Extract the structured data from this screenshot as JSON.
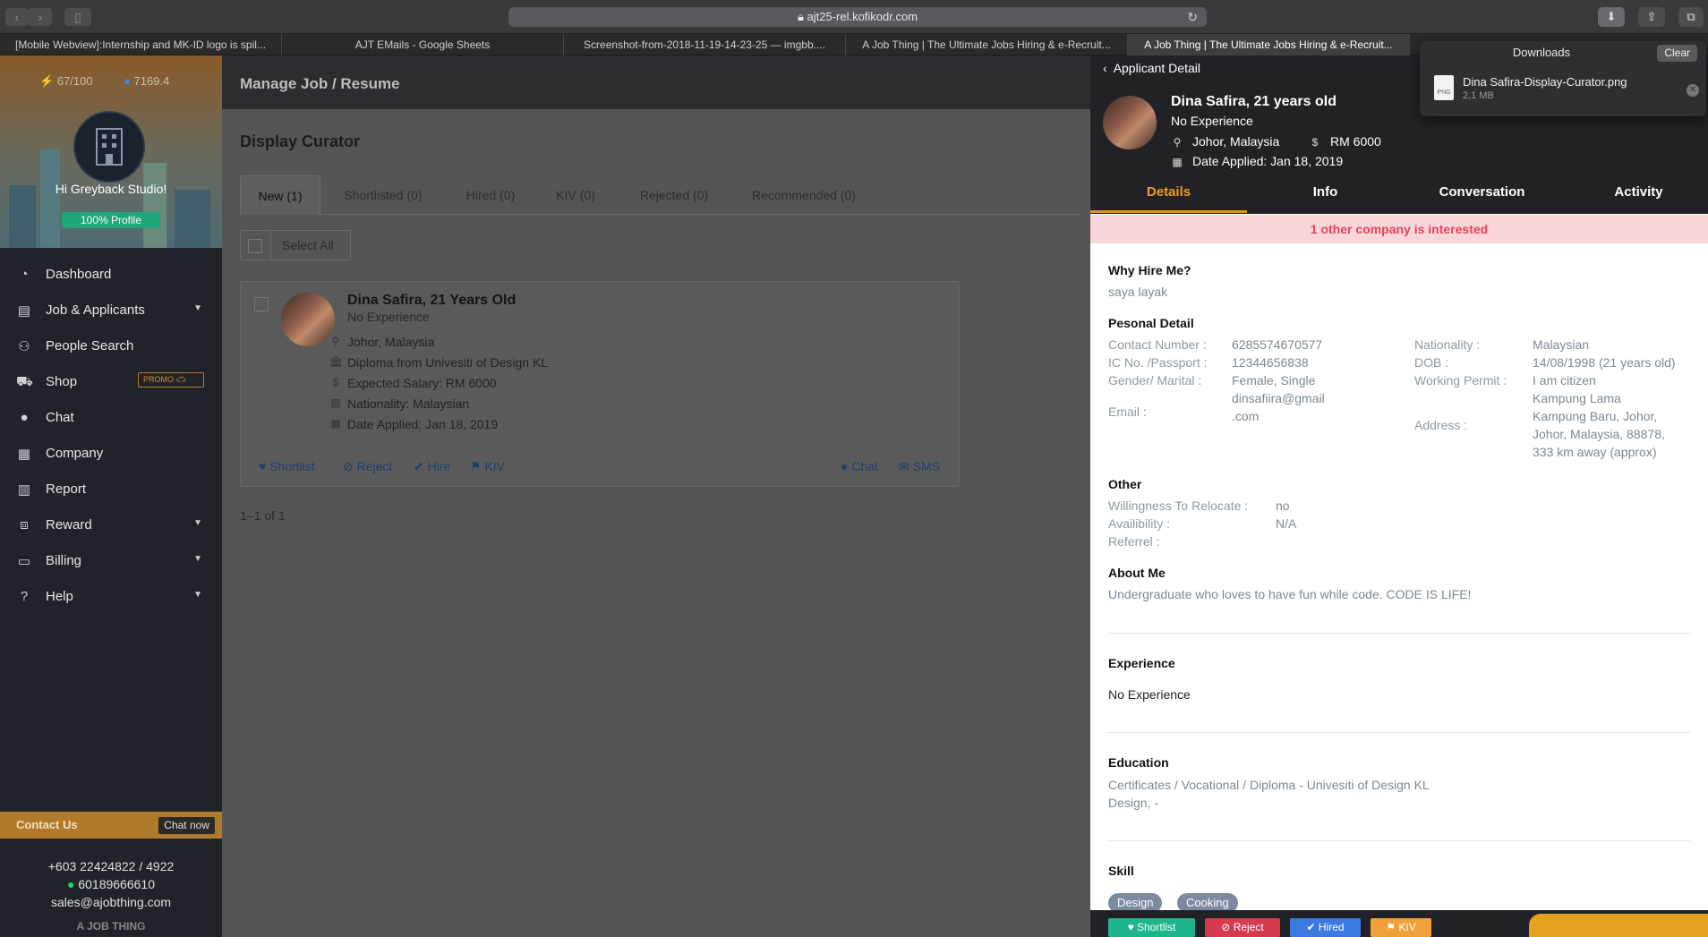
{
  "browser": {
    "url": "ajt25-rel.kofikodr.com",
    "tabs": [
      "[Mobile Webview]:Internship and MK-ID logo is spil...",
      "AJT EMails - Google Sheets",
      "Screenshot-from-2018-11-19-14-23-25 — imgbb....",
      "A Job Thing | The Ultimate Jobs Hiring & e-Recruit...",
      "A Job Thing | The Ultimate Jobs Hiring & e-Recruit..."
    ]
  },
  "downloads": {
    "title": "Downloads",
    "clear_label": "Clear",
    "file_type": "PNG",
    "file_name": "Dina Safira-Display-Curator.png",
    "file_size": "2,1 MB"
  },
  "sidebar": {
    "energy": "67/100",
    "credits": "7169.4",
    "greeting": "Hi Greyback Studio!",
    "profile_badge": "100% Profile",
    "promo_badge": "PROMO",
    "items": [
      {
        "label": "Dashboard",
        "icon": "dashboard-icon",
        "glyph": "◔"
      },
      {
        "label": "Job & Applicants",
        "icon": "document-icon",
        "glyph": "▤",
        "caret": true
      },
      {
        "label": "People Search",
        "icon": "people-icon",
        "glyph": "⚇"
      },
      {
        "label": "Shop",
        "icon": "cart-icon",
        "glyph": "⛟"
      },
      {
        "label": "Chat",
        "icon": "chat-icon",
        "glyph": "●"
      },
      {
        "label": "Company",
        "icon": "building-icon",
        "glyph": "▦"
      },
      {
        "label": "Report",
        "icon": "bar-chart-icon",
        "glyph": "▥"
      },
      {
        "label": "Reward",
        "icon": "gift-icon",
        "glyph": "⧈",
        "caret": true
      },
      {
        "label": "Billing",
        "icon": "credit-card-icon",
        "glyph": "▭",
        "caret": true
      },
      {
        "label": "Help",
        "icon": "question-icon",
        "glyph": "?",
        "caret": true
      }
    ],
    "contact_title": "Contact Us",
    "chat_now": "Chat now",
    "phone": "+603 22424822 / 4922",
    "whatsapp": "60189666610",
    "email": "sales@ajobthing.com",
    "logo_text": "A JOB THING"
  },
  "main": {
    "header": "Manage Job / Resume",
    "job_title": "Display Curator",
    "tabs": [
      "New (1)",
      "Shortlisted (0)",
      "Hired (0)",
      "KIV (0)",
      "Rejected (0)",
      "Recommended (0)"
    ],
    "select_all": "Select All",
    "card": {
      "name": "Dina Safira, 21 Years Old",
      "experience": "No Experience",
      "location": "Johor, Malaysia",
      "education": "Diploma from Univesiti of Design KL",
      "salary": "Expected Salary: RM 6000",
      "nationality": "Nationality: Malaysian",
      "date_applied": "Date Applied: Jan 18, 2019",
      "actions": [
        "Shortlist",
        "Reject",
        "Hire",
        "KIV"
      ],
      "chat": "Chat",
      "sms": "SMS"
    },
    "pager": "1–1 of 1"
  },
  "panel": {
    "back_label": "Applicant Detail",
    "name": "Dina Safira, 21 years old",
    "experience": "No Experience",
    "location": "Johor, Malaysia",
    "salary": "RM 6000",
    "date_applied": "Date Applied: Jan 18, 2019",
    "tabs": [
      "Details",
      "Info",
      "Conversation",
      "Activity"
    ],
    "interest_banner": "1 other company is interested",
    "why_hire_title": "Why Hire Me?",
    "why_hire": "saya layak",
    "personal_title": "Pesonal Detail",
    "contact_label": "Contact Number :",
    "contact": "6285574670577",
    "ic_label": "IC No. /Passport :",
    "ic": "12344656838",
    "gender_label": "Gender/ Marital :",
    "gender": "Female, Single",
    "email_label": "Email :",
    "email_line1": "dinsafiira@gmail",
    "email_line2": ".com",
    "nationality_label": "Nationality :",
    "nationality": "Malaysian",
    "dob_label": "DOB :",
    "dob": "14/08/1998 (21 years old)",
    "permit_label": "Working Permit :",
    "permit": "I am citizen",
    "address_label": "Address :",
    "address_lines": [
      "Kampung Lama",
      "Kampung Baru, Johor,",
      "Johor, Malaysia, 88878,",
      "333 km away (approx)"
    ],
    "other_title": "Other",
    "relocate_label": "Willingness To Relocate :",
    "relocate": "no",
    "avail_label": "Availibility :",
    "avail": "N/A",
    "referrel_label": "Referrel :",
    "about_title": "About Me",
    "about": "Undergraduate who loves to have fun while code. CODE IS LIFE!",
    "experience_title": "Experience",
    "experience_value": "No Experience",
    "education_title": "Education",
    "education_line1": "Certificates / Vocational / Diploma - Univesiti of Design KL",
    "education_line2": "Design, -",
    "skill_title": "Skill",
    "skills": [
      "Design",
      "Cooking"
    ],
    "footer_buttons": [
      {
        "label": "Shortlist",
        "color": "#1db58a"
      },
      {
        "label": "Reject",
        "color": "#d63a4f"
      },
      {
        "label": "Hired",
        "color": "#3b7be0"
      },
      {
        "label": "KIV",
        "color": "#f0a13a"
      }
    ]
  },
  "colors": {
    "accent_orange": "#f29b1e",
    "banner_red": "#e8445a",
    "sidebar_bg": "#202329",
    "profile_green": "#1fa67a"
  }
}
